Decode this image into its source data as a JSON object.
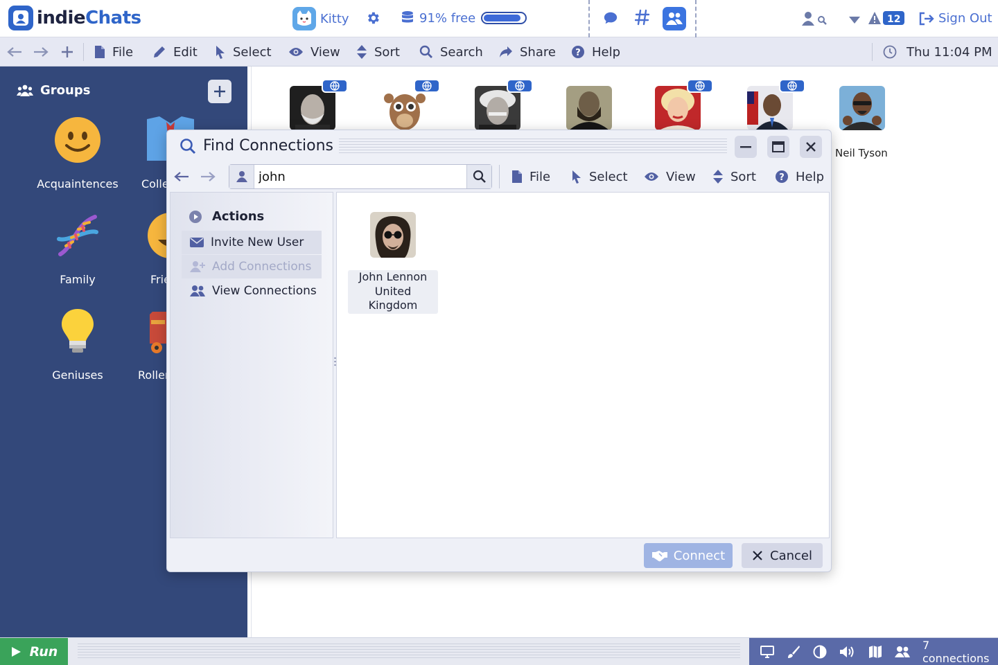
{
  "app": {
    "logo_part1": "indie",
    "logo_part2": "Chats"
  },
  "header": {
    "user_name": "Kitty",
    "storage_text": "91% free",
    "storage_fraction": 0.91,
    "notification_count": "12",
    "sign_out_label": "Sign Out"
  },
  "menubar": {
    "file": "File",
    "edit": "Edit",
    "select": "Select",
    "view": "View",
    "sort": "Sort",
    "search": "Search",
    "share": "Share",
    "help": "Help",
    "clock": "Thu 11:04 PM"
  },
  "sidebar": {
    "title": "Groups",
    "groups": [
      {
        "label": "Acquaintences",
        "icon": "smiley-icon"
      },
      {
        "label": "Colle",
        "icon": "shirt-tie-icon"
      },
      {
        "label": "Family",
        "icon": "dna-icon"
      },
      {
        "label": "Frie",
        "icon": "smiley-icon"
      },
      {
        "label": "Geniuses",
        "icon": "lightbulb-icon"
      },
      {
        "label": "Roller",
        "icon": "roller-skate-icon"
      }
    ]
  },
  "contacts": {
    "visible_name": "Neil Tyson"
  },
  "dialog": {
    "title": "Find Connections",
    "search_value": "john",
    "toolbar": {
      "file": "File",
      "select": "Select",
      "view": "View",
      "sort": "Sort",
      "help": "Help"
    },
    "actions": {
      "heading": "Actions",
      "items": [
        {
          "label": "Invite New User",
          "enabled": true
        },
        {
          "label": "Add Connections",
          "enabled": false
        },
        {
          "label": "View Connections",
          "enabled": true
        }
      ]
    },
    "results": [
      {
        "name": "John Lennon",
        "country_line1": "United",
        "country_line2": "Kingdom"
      }
    ],
    "connect_label": "Connect",
    "cancel_label": "Cancel"
  },
  "bottombar": {
    "run_label": "Run",
    "connections_label": "7 connections"
  },
  "colors": {
    "accent": "#2f65c9",
    "sidebar": "#33487a",
    "run": "#3aa35a",
    "status": "#5a6aa8"
  }
}
